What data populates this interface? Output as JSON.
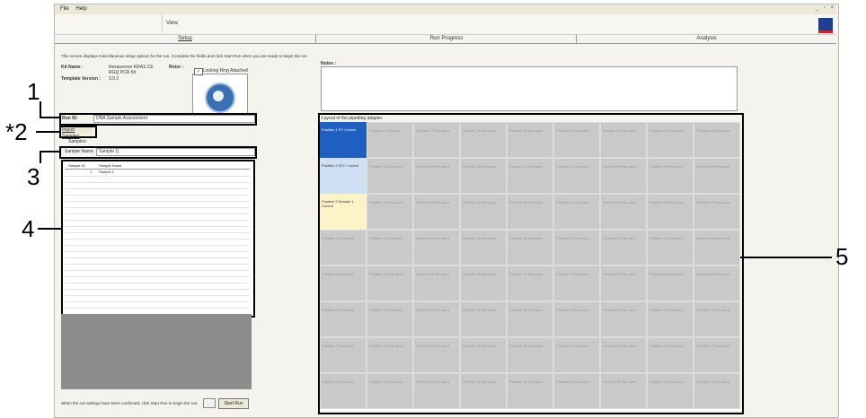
{
  "menu": {
    "file": "File",
    "help": "Help"
  },
  "toolbar": {
    "view": "View"
  },
  "tabs": [
    "Setup",
    "Run Progress",
    "Analysis"
  ],
  "setup": {
    "instructions": "This screen displays miscellaneous setup options for the run. Complete the fields and click Start Run when you are ready to begin the run.",
    "kit_name_label": "Kit Name :",
    "kit_name_value": "therascreen KRAS CE RGQ PCR Kit",
    "template_version_label": "Template Version :",
    "template_version_value": "3.0.2",
    "rotor_label": "Rotor :",
    "rotor_checkbox": "Locking Ring Attached",
    "run_id_label": "Run ID:",
    "run_id_value": "DNA Sample Assessment",
    "import_button": "Import Samples",
    "samples_label": "Samples:",
    "sample_name_label": "Sample Name:",
    "sample_name_value": "Sample 1|",
    "table_headers": [
      "Sample ID",
      "Sample Name"
    ],
    "table_rows": [
      {
        "id": "1",
        "name": "Sample 1"
      }
    ],
    "footer_text": "When the run settings have been confirmed, click Start Run to begin the run.",
    "start_button": "Start Run"
  },
  "notes": {
    "label": "Notes :"
  },
  "layout": {
    "caption": "Layout of the pipetting adapter",
    "special": [
      {
        "label": "Position 1",
        "sub1": "PC",
        "sub2": "Control",
        "color": "#1f5fbf",
        "text": "#ffffff"
      },
      {
        "label": "Position 2",
        "sub1": "NTC",
        "sub2": "Control",
        "color": "#cfe0f5",
        "text": "#333333"
      },
      {
        "label": "Position 3",
        "sub1": "Sample 1",
        "sub2": "Control",
        "color": "#fdf3c8",
        "text": "#333333"
      }
    ],
    "not_used": "Not used",
    "position_word": "Position"
  },
  "callouts": [
    "1",
    "*2",
    "3",
    "4",
    "5"
  ]
}
